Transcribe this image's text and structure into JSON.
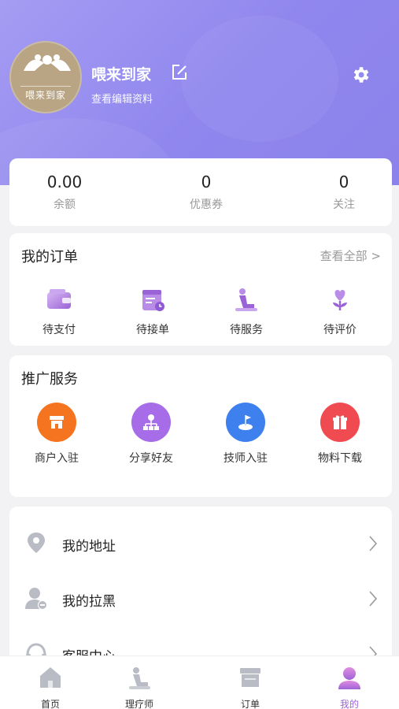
{
  "profile": {
    "name": "喂来到家",
    "edit_profile": "查看编辑资料",
    "avatar_text": "喂来到家"
  },
  "stats": [
    {
      "value": "0.00",
      "label": "余额"
    },
    {
      "value": "0",
      "label": "优惠券"
    },
    {
      "value": "0",
      "label": "关注"
    }
  ],
  "orders": {
    "title": "我的订单",
    "see_all": "查看全部 >",
    "items": [
      {
        "label": "待支付",
        "icon": "wallet-icon"
      },
      {
        "label": "待接单",
        "icon": "calendar-clock-icon"
      },
      {
        "label": "待服务",
        "icon": "massage-icon"
      },
      {
        "label": "待评价",
        "icon": "flower-heart-icon"
      }
    ]
  },
  "promo": {
    "title": "推广服务",
    "items": [
      {
        "label": "商户入驻",
        "icon": "store-icon",
        "color": "#f5741f"
      },
      {
        "label": "分享好友",
        "icon": "network-icon",
        "color": "#a76ce8"
      },
      {
        "label": "技师入驻",
        "icon": "flag-icon",
        "color": "#3f80ef"
      },
      {
        "label": "物料下载",
        "icon": "gift-icon",
        "color": "#ef4b50"
      }
    ]
  },
  "menu": [
    {
      "label": "我的地址",
      "icon": "location-pin-icon"
    },
    {
      "label": "我的拉黑",
      "icon": "user-block-icon"
    },
    {
      "label": "客服中心",
      "icon": "headset-icon"
    }
  ],
  "tabbar": [
    {
      "label": "首页",
      "icon": "home-icon"
    },
    {
      "label": "理疗师",
      "icon": "therapist-icon"
    },
    {
      "label": "订单",
      "icon": "order-store-icon"
    },
    {
      "label": "我的",
      "icon": "profile-icon",
      "active": true
    }
  ],
  "colors": {
    "header": "#918aef",
    "accent": "#9f63d8",
    "icon_gray": "#b9bcc5"
  }
}
